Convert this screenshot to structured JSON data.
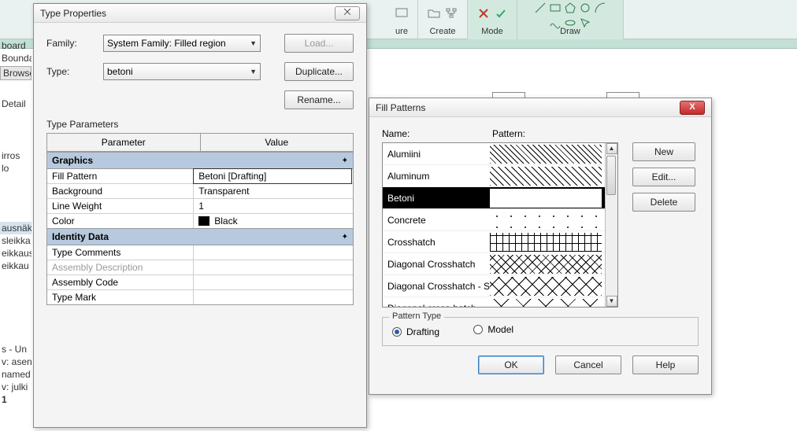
{
  "ribbon": {
    "panels": [
      {
        "label": "ure"
      },
      {
        "label": "Create"
      },
      {
        "label": "Mode"
      },
      {
        "label": "Draw"
      }
    ]
  },
  "side_fragments": {
    "a": "board",
    "b": "Bounda",
    "browse": "Browse",
    "detail": "Detail",
    "c": "irros",
    "d": "lo",
    "e": "ausnäk",
    "f": "sleikka",
    "g": "eikkaus",
    "h": "eikkau",
    "i": "s - Un",
    "j": "v: asen",
    "k": "named",
    "l": "v: julki",
    "m": "1"
  },
  "type_properties": {
    "title": "Type Properties",
    "close_glyph": "⨉",
    "family_label": "Family:",
    "family_value": "System Family: Filled region",
    "type_label": "Type:",
    "type_value": "betoni",
    "load": "Load...",
    "duplicate": "Duplicate...",
    "rename": "Rename...",
    "type_params_label": "Type Parameters",
    "col_parameter": "Parameter",
    "col_value": "Value",
    "group_graphics": "Graphics",
    "group_identity": "Identity Data",
    "rows_graphics": [
      {
        "p": "Fill Pattern",
        "v": "Betoni [Drafting]",
        "boxed": true
      },
      {
        "p": "Background",
        "v": "Transparent"
      },
      {
        "p": "Line Weight",
        "v": "1"
      },
      {
        "p": "Color",
        "v": "Black",
        "swatch": true
      }
    ],
    "rows_identity": [
      {
        "p": "Type Comments",
        "v": ""
      },
      {
        "p": "Assembly Description",
        "v": "",
        "grey": true
      },
      {
        "p": "Assembly Code",
        "v": ""
      },
      {
        "p": "Type Mark",
        "v": ""
      }
    ]
  },
  "fill_patterns": {
    "title": "Fill Patterns",
    "close_glyph": "X",
    "name_label": "Name:",
    "pattern_label": "Pattern:",
    "new": "New",
    "edit": "Edit...",
    "delete": "Delete",
    "items": [
      {
        "name": "Alumiini",
        "cls": "pat-hatch"
      },
      {
        "name": "Aluminum",
        "cls": "pat-hatch2"
      },
      {
        "name": "Betoni",
        "cls": "pat-dots",
        "selected": true
      },
      {
        "name": "Concrete",
        "cls": "pat-dots-sparse"
      },
      {
        "name": "Crosshatch",
        "cls": "pat-cross"
      },
      {
        "name": "Diagonal Crosshatch",
        "cls": "pat-diagcross"
      },
      {
        "name": "Diagonal Crosshatch - S",
        "cls": "pat-diagcross-s"
      },
      {
        "name": "Diagonal cross-hatch",
        "cls": "pat-diagcross-l"
      }
    ],
    "pattern_type_label": "Pattern Type",
    "drafting": "Drafting",
    "model": "Model",
    "ok": "OK",
    "cancel": "Cancel",
    "help": "Help"
  }
}
